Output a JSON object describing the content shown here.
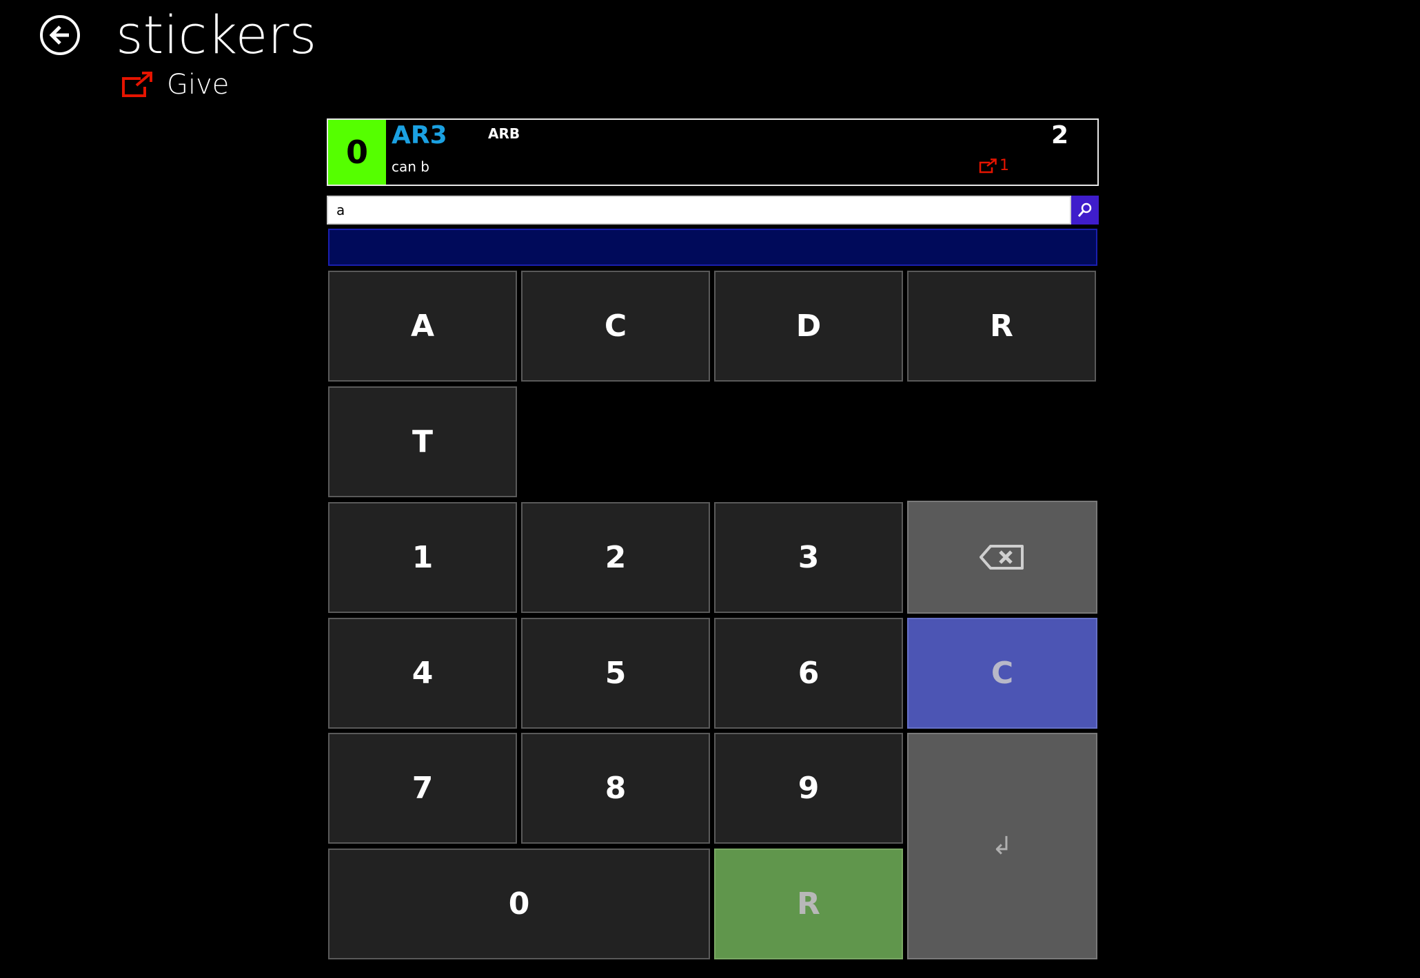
{
  "header": {
    "title": "stickers",
    "subtitle": "Give"
  },
  "item": {
    "quantity": "0",
    "code": "AR3",
    "category": "ARB",
    "description": "can b",
    "count": "2",
    "given": "1"
  },
  "search": {
    "value": "a",
    "placeholder": ""
  },
  "keypad": {
    "letters": [
      "A",
      "C",
      "D",
      "R",
      "T"
    ],
    "digits": [
      "1",
      "2",
      "3",
      "4",
      "5",
      "6",
      "7",
      "8",
      "9"
    ],
    "zero": "0",
    "clear": "C",
    "enter": "↲",
    "reset": "R"
  },
  "colors": {
    "quantity_bg": "#55ff00",
    "code": "#1ba1e2",
    "give_icon": "#e51400",
    "search_button": "#3f1dcb",
    "clear_key": "#4c55b4",
    "reset_key": "#60964c"
  }
}
